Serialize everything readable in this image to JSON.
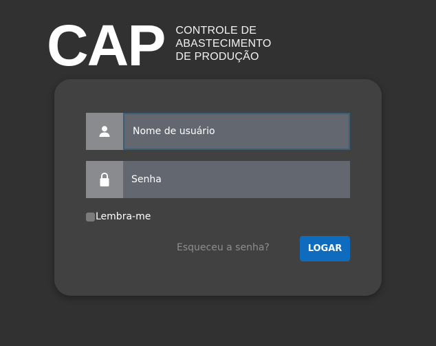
{
  "logo": {
    "mark": "CAP",
    "subtitle_lines": [
      "CONTROLE DE",
      "ABASTECIMENTO",
      "DE PRODUÇÃO"
    ]
  },
  "form": {
    "username": {
      "icon": "user-icon",
      "placeholder": "Nome de usuário",
      "value": ""
    },
    "password": {
      "icon": "lock-icon",
      "placeholder": "Senha",
      "value": ""
    },
    "remember_label": "Lembra-me",
    "remember_checked": false,
    "forgot_label": "Esqueceu a senha?",
    "login_label": "LOGAR"
  },
  "colors": {
    "background": "#313131",
    "card": "#414141",
    "input": "#636870",
    "icon_box": "#8a8b8f",
    "button": "#0f6bbd",
    "focus_border": "#3a5f7a"
  }
}
